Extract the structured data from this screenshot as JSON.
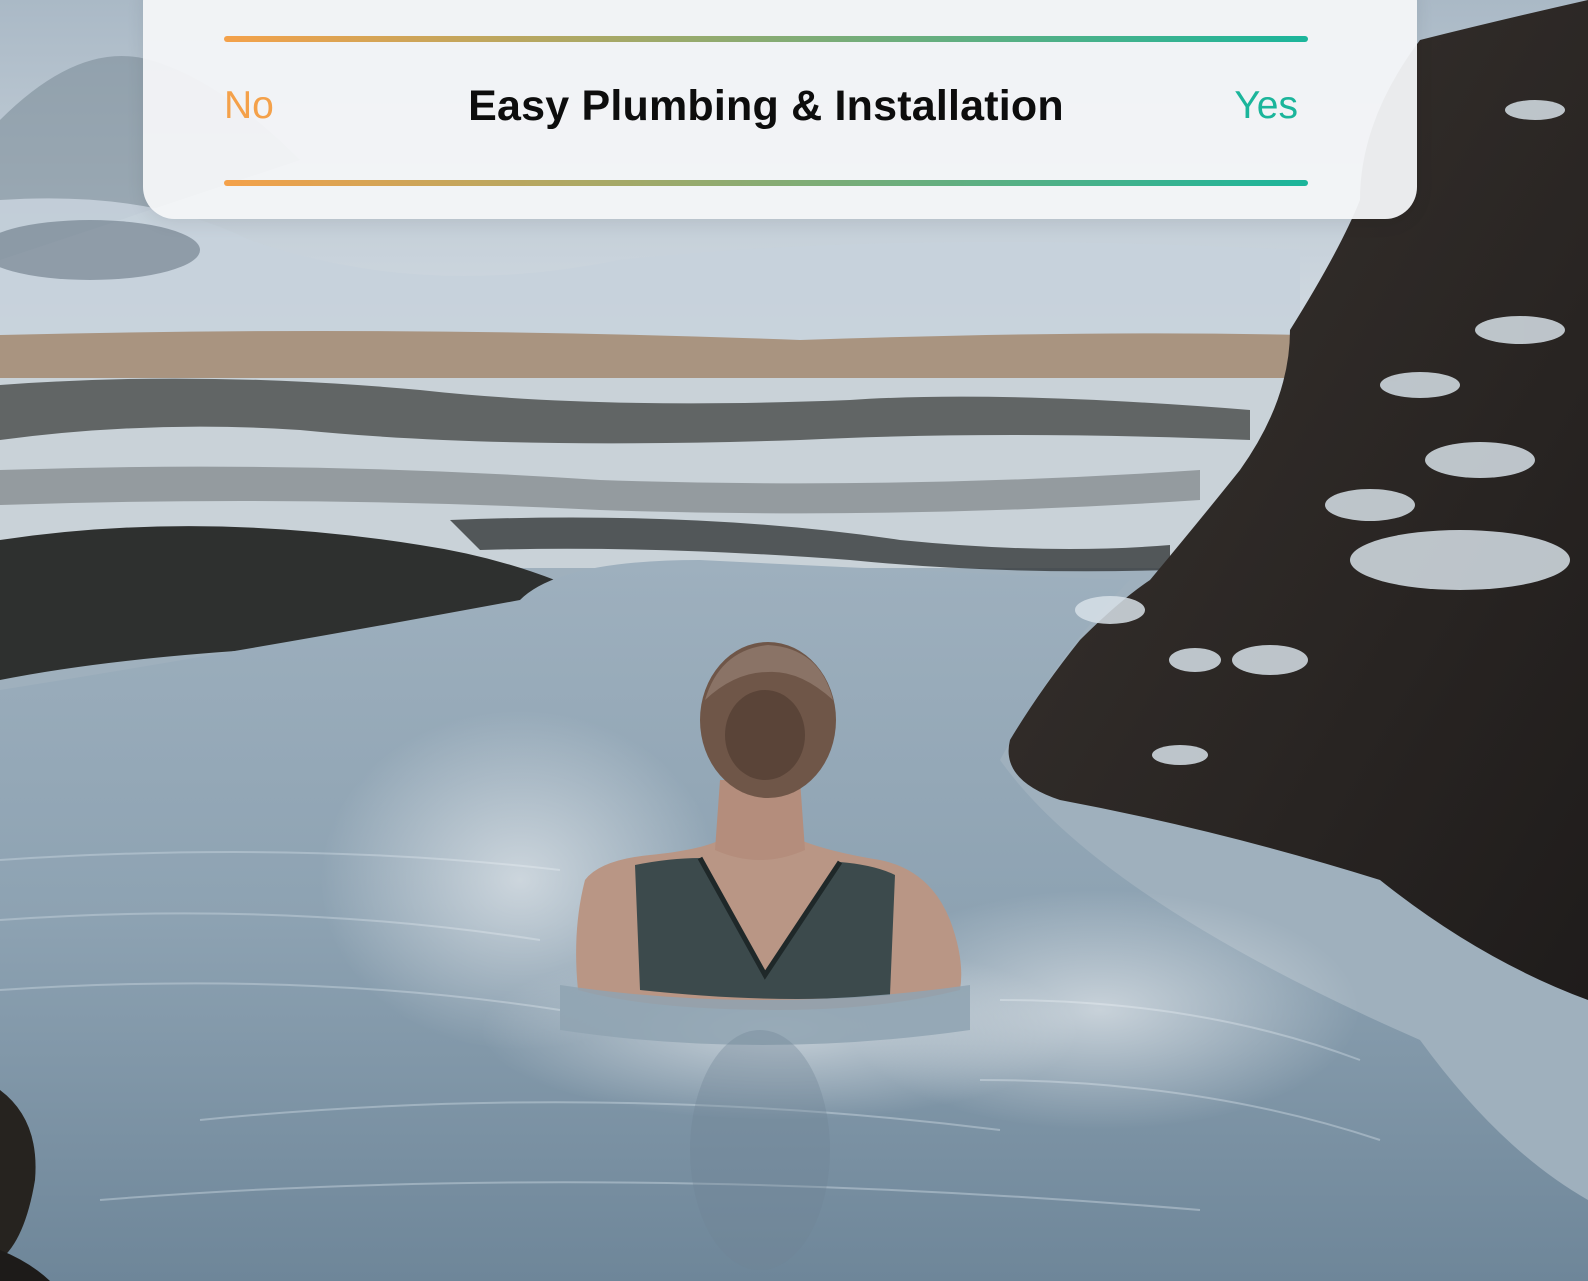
{
  "card": {
    "no_label": "No",
    "title": "Easy Plumbing & Installation",
    "yes_label": "Yes"
  },
  "colors": {
    "no": "#f4a14a",
    "yes": "#1bb59b",
    "gradient_start": "#f4a14a",
    "gradient_end": "#1bb59b",
    "title": "#0d0d0d"
  },
  "background": {
    "description_icon": "photo-woman-in-geothermal-hot-spring"
  }
}
